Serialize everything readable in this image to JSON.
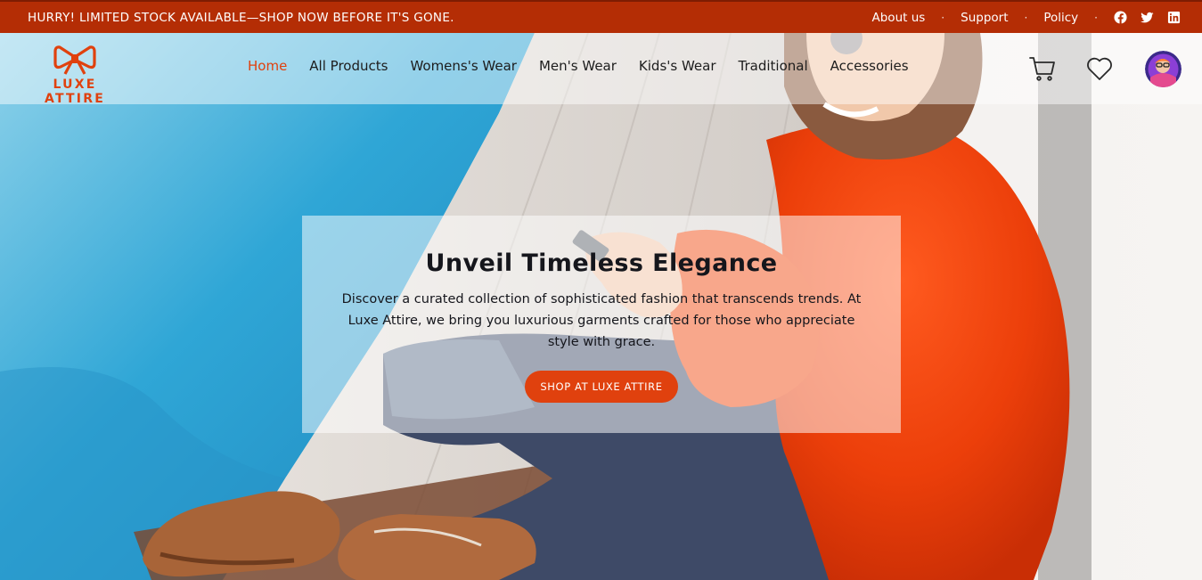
{
  "announcement": {
    "text": "HURRY! LIMITED STOCK AVAILABLE—SHOP NOW BEFORE IT'S GONE.",
    "links": [
      "About us",
      "Support",
      "Policy"
    ],
    "separator": "·",
    "social_icons": [
      "facebook-icon",
      "twitter-icon",
      "linkedin-icon"
    ]
  },
  "brand": {
    "name": "LUXE ATTIRE",
    "logo_icon": "bow-icon"
  },
  "nav": {
    "items": [
      "Home",
      "All Products",
      "Womens's Wear",
      "Men's Wear",
      "Kids's Wear",
      "Traditional",
      "Accessories"
    ],
    "active": "Home",
    "icons": [
      "cart-icon",
      "heart-icon",
      "avatar"
    ]
  },
  "hero": {
    "title": "Unveil Timeless Elegance",
    "description": "Discover a curated collection of sophisticated fashion that transcends trends. At Luxe Attire, we bring you luxurious garments crafted for those who appreciate style with grace.",
    "cta": "SHOP AT LUXE ATTIRE"
  },
  "colors": {
    "announcement_bg": "#b42d05",
    "accent": "#e0410e",
    "text_dark": "#15161c"
  }
}
